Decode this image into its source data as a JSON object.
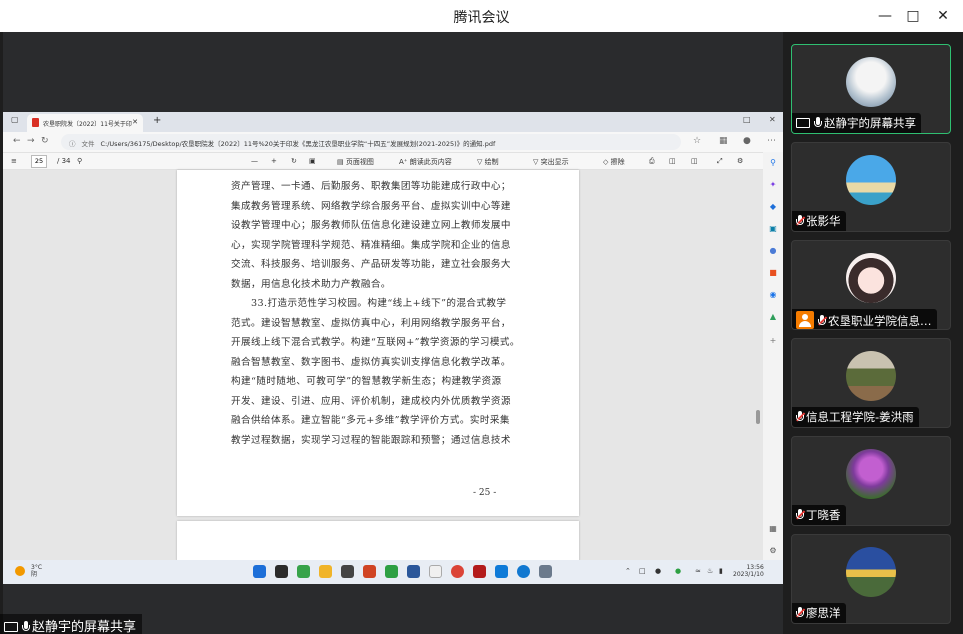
{
  "window": {
    "title": "腾讯会议",
    "minimize_icon": "minimize-icon",
    "maximize_icon": "maximize-icon",
    "close_icon": "close-icon"
  },
  "share_label": "赵静宇的屏幕共享",
  "browser": {
    "tab_title": "农垦职院发〔2022〕11号关于印",
    "url_label": "文件",
    "url": "C:/Users/36175/Desktop/农垦职院发〔2022〕11号%20关于印发《黑龙江农垦职业学院“十四五”发展规划(2021-2025)》的通知.pdf",
    "pdf_toolbar": {
      "page_current": "25",
      "page_total": "/ 34",
      "page_view": "页面视图",
      "read_aloud": "朗读此页内容",
      "draw": "绘制",
      "highlight": "突出显示",
      "erase": "擦除"
    },
    "pdf_lines": [
      "资产管理、一卡通、后勤服务、职教集团等功能建成行政中心；",
      "集成教务管理系统、网络教学综合服务平台、虚拟实训中心等建",
      "设教学管理中心；服务教师队伍信息化建设建立网上教师发展中",
      "心，实现学院管理科学规范、精准精细。集成学院和企业的信息",
      "交流、科技服务、培训服务、产品研发等功能，建立社会服务大",
      "数据，用信息化技术助力产教融合。",
      "33.打造示范性学习校园。构建“线上+线下”的混合式教学",
      "范式。建设智慧教室、虚拟仿真中心，利用网络教学服务平台，",
      "开展线上线下混合式教学。构建“互联网+”教学资源的学习模式。",
      "融合智慧教室、数字图书、虚拟仿真实训支撑信息化教学改革。",
      "构建“随时随地、可教可学”的智慧教学新生态；构建教学资源",
      "开发、建设、引进、应用、评价机制，建成校内外优质教学资源",
      "融合供给体系。建立智能“多元+多维”教学评价方式。实时采集",
      "教学过程数据，实现学习过程的智能跟踪和预警；通过信息技术"
    ],
    "page_number": "- 25 -",
    "taskbar": {
      "weather_temp": "3°C",
      "weather_desc": "阴",
      "time": "13:56",
      "date": "2023/1/10"
    }
  },
  "participants": [
    {
      "name": "赵静宇的屏幕共享",
      "avatar_icon": "snow-tree-avatar",
      "sharing": true
    },
    {
      "name": "张影华",
      "avatar_icon": "palm-tree-avatar",
      "muted": true
    },
    {
      "name": "农垦职业学院信息…",
      "avatar_icon": "anime-girl-avatar",
      "muted": true
    },
    {
      "name": "信息工程学院-姜洪雨",
      "avatar_icon": "greenhouse-avatar",
      "muted": true
    },
    {
      "name": "丁晓香",
      "avatar_icon": "purple-flowers-avatar",
      "muted": true
    },
    {
      "name": "廖思洋",
      "avatar_icon": "person-outdoor-avatar",
      "muted": true
    }
  ]
}
